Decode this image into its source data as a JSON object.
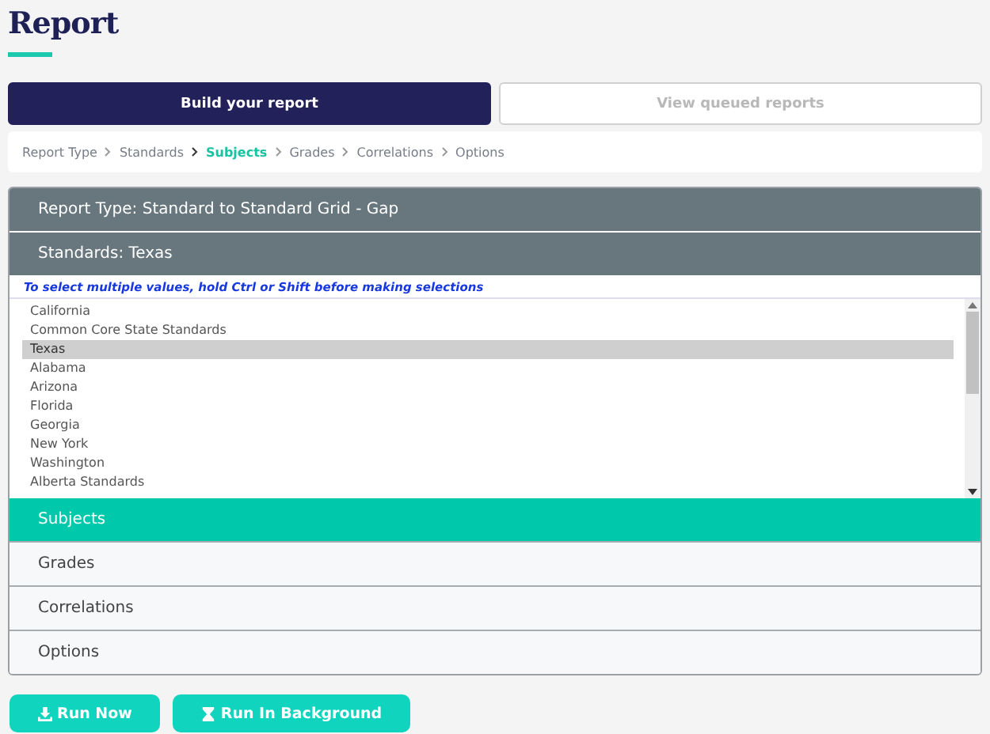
{
  "page_title": "Report",
  "tabs": [
    {
      "label": "Build your report",
      "selected": true
    },
    {
      "label": "View queued reports",
      "selected": false
    }
  ],
  "breadcrumb": [
    {
      "label": "Report Type",
      "selected": false
    },
    {
      "label": "Standards",
      "selected": false
    },
    {
      "label": "Subjects",
      "selected": true
    },
    {
      "label": "Grades",
      "selected": false
    },
    {
      "label": "Correlations",
      "selected": false
    },
    {
      "label": "Options",
      "selected": false
    }
  ],
  "sections": [
    {
      "title": "Report Type: Standard to Standard Grid - Gap",
      "completed": true,
      "selected": false
    },
    {
      "title": "Standards: Texas",
      "completed": true,
      "selected": false,
      "kind": "list"
    },
    {
      "title": "Subjects",
      "completed": false,
      "selected": true
    },
    {
      "title": "Grades",
      "completed": false,
      "selected": false
    },
    {
      "title": "Correlations",
      "completed": false,
      "selected": false
    },
    {
      "title": "Options",
      "completed": false,
      "selected": false
    }
  ],
  "standards_list": {
    "hint": "To select multiple values, hold Ctrl or Shift before making selections",
    "items": [
      {
        "label": "California",
        "selected": false
      },
      {
        "label": "Common Core State Standards",
        "selected": false
      },
      {
        "label": "Texas",
        "selected": true
      },
      {
        "label": "Alabama",
        "selected": false
      },
      {
        "label": "Arizona",
        "selected": false
      },
      {
        "label": "Florida",
        "selected": false
      },
      {
        "label": "Georgia",
        "selected": false
      },
      {
        "label": "New York",
        "selected": false
      },
      {
        "label": "Washington",
        "selected": false
      },
      {
        "label": "Alberta Standards",
        "selected": false
      }
    ]
  },
  "actions": [
    {
      "label": "Run Now",
      "kind": "download"
    },
    {
      "label": "Run In Background",
      "kind": "hourglass"
    }
  ]
}
